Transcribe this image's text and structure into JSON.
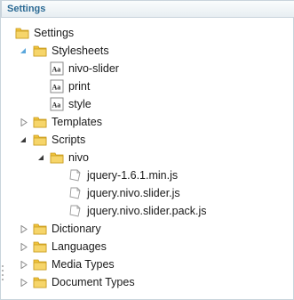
{
  "header": {
    "title": "Settings"
  },
  "tree": {
    "settings": "Settings",
    "stylesheets": "Stylesheets",
    "nivo_slider": "nivo-slider",
    "print": "print",
    "style": "style",
    "templates": "Templates",
    "scripts": "Scripts",
    "nivo": "nivo",
    "jquery": "jquery-1.6.1.min.js",
    "jquery_nivo": "jquery.nivo.slider.js",
    "jquery_nivo_pack": "jquery.nivo.slider.pack.js",
    "dictionary": "Dictionary",
    "languages": "Languages",
    "media_types": "Media Types",
    "document_types": "Document Types"
  },
  "icons": {
    "folder": "folder-icon",
    "stylesheet": "stylesheet-icon",
    "script": "script-file-icon"
  },
  "colors": {
    "title": "#2b6a94",
    "folder": "#f0c33c",
    "expanded_selected": "#5aa7dc"
  }
}
